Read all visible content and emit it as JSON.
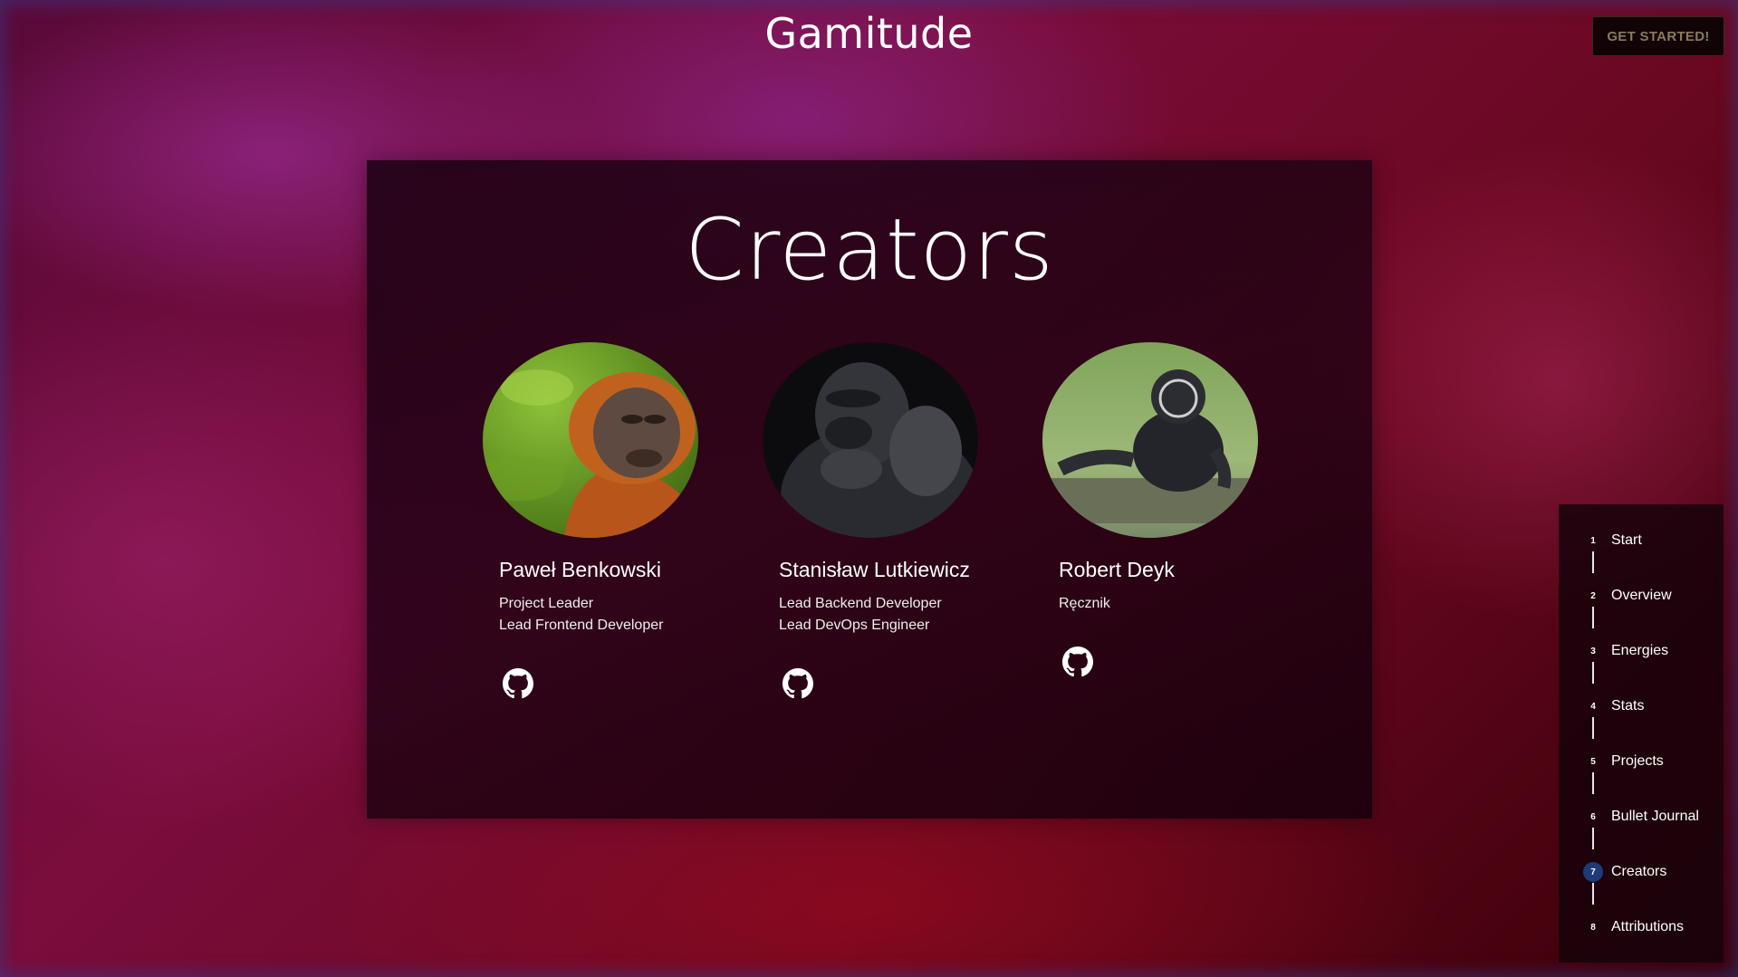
{
  "header": {
    "site_title": "Gamitude",
    "cta_label": "GET STARTED!"
  },
  "section": {
    "title": "Creators"
  },
  "creators": [
    {
      "name": "Paweł Benkowski",
      "roles": [
        "Project Leader",
        "Lead Frontend Developer"
      ],
      "avatar_icon": "orangutan-photo",
      "link_icon": "github-icon"
    },
    {
      "name": "Stanisław Lutkiewicz",
      "roles": [
        "Lead Backend Developer",
        "Lead DevOps Engineer"
      ],
      "avatar_icon": "gorilla-photo",
      "link_icon": "github-icon"
    },
    {
      "name": "Robert Deyk",
      "roles": [
        "Ręcznik"
      ],
      "avatar_icon": "gibbon-photo",
      "link_icon": "github-icon"
    }
  ],
  "steps_nav": {
    "active_index": 7,
    "active_color": "#1e3a7a",
    "items": [
      {
        "number": "1",
        "label": "Start"
      },
      {
        "number": "2",
        "label": "Overview"
      },
      {
        "number": "3",
        "label": "Energies"
      },
      {
        "number": "4",
        "label": "Stats"
      },
      {
        "number": "5",
        "label": "Projects"
      },
      {
        "number": "6",
        "label": "Bullet Journal"
      },
      {
        "number": "7",
        "label": "Creators"
      },
      {
        "number": "8",
        "label": "Attributions"
      }
    ]
  }
}
